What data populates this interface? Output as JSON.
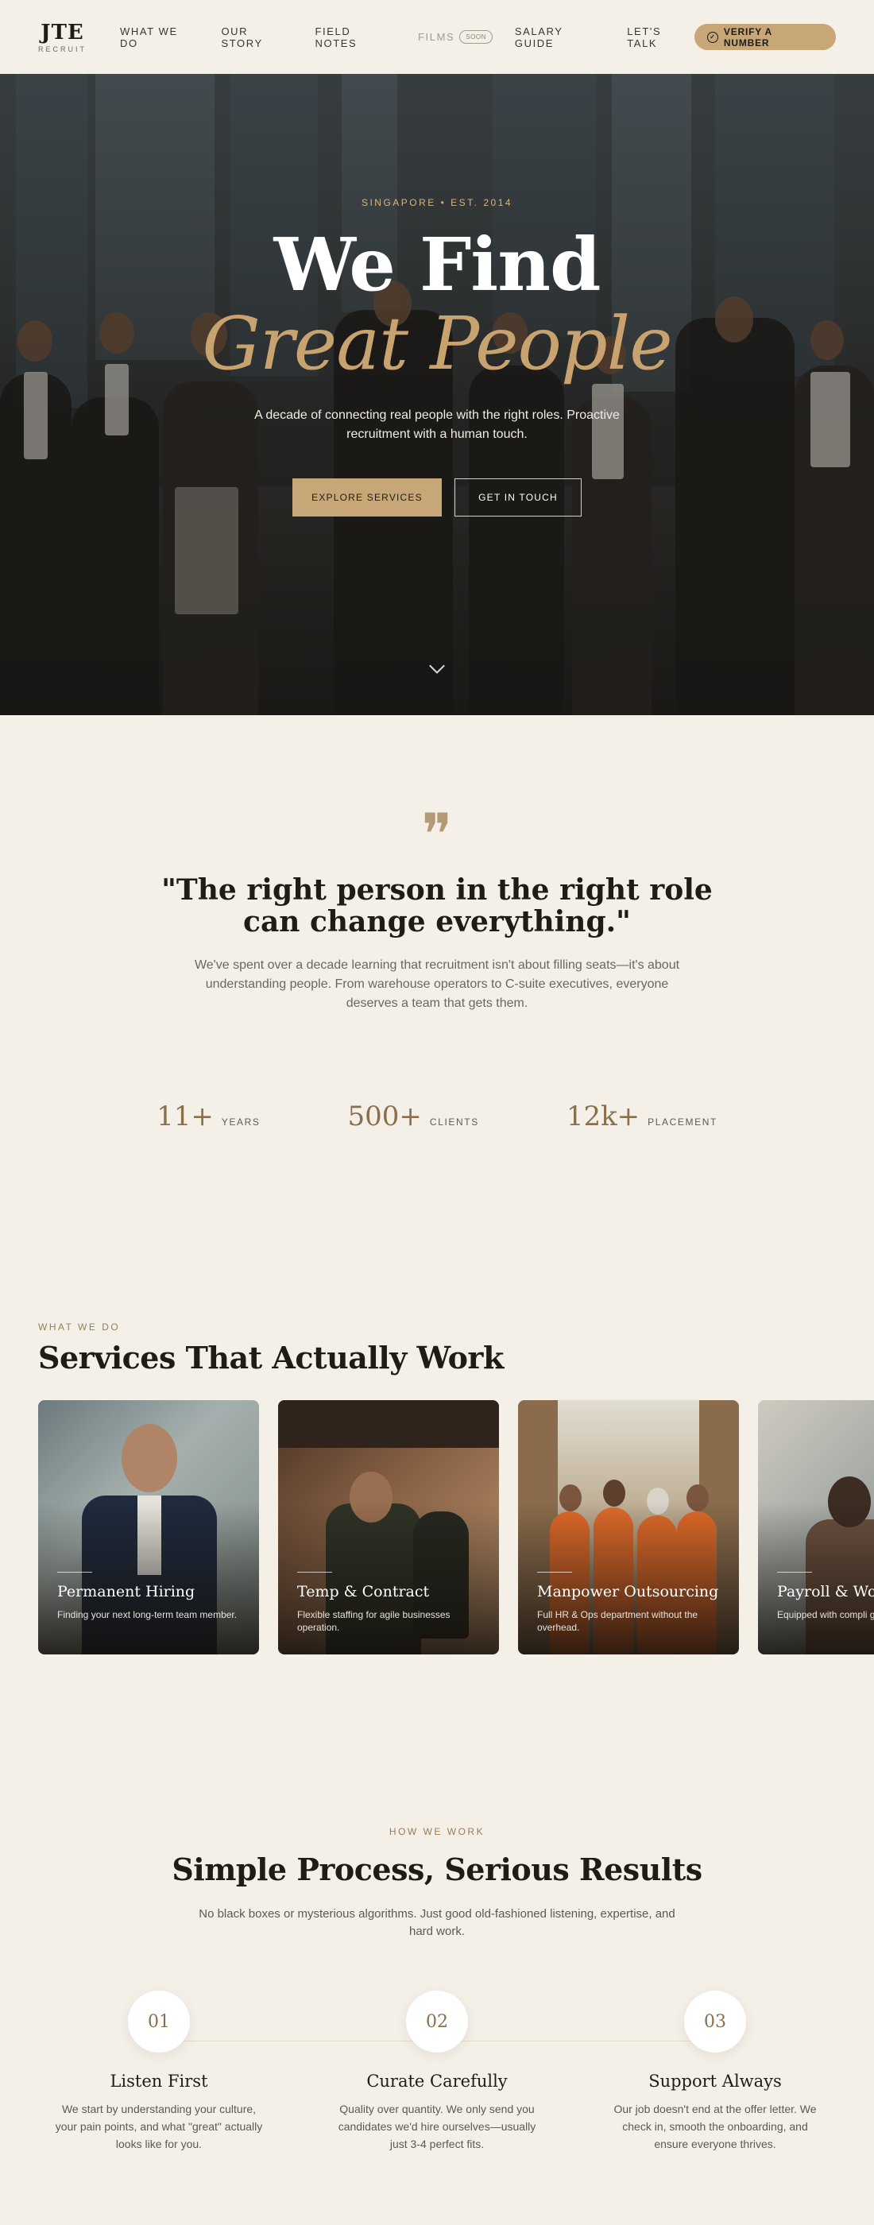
{
  "nav": {
    "logo_main": "JTE",
    "logo_sub": "RECRUIT",
    "links": [
      "WHAT WE DO",
      "OUR STORY",
      "FIELD NOTES",
      "FILMS",
      "SALARY GUIDE",
      "LET'S TALK"
    ],
    "films_badge": "SOON",
    "verify_label": "VERIFY A NUMBER"
  },
  "hero": {
    "eyebrow": "SINGAPORE • EST. 2014",
    "title_line1": "We Find",
    "title_line2": "Great People",
    "subtitle": "A decade of connecting real people with the right roles. Proactive recruitment with a human touch.",
    "primary_cta": "EXPLORE SERVICES",
    "secondary_cta": "GET IN TOUCH"
  },
  "quote": {
    "mark": "❞",
    "text": "\"The right person in the right role can change everything.\"",
    "body": "We've spent over a decade learning that recruitment isn't about filling seats—it's about understanding people. From warehouse operators to C-suite executives, everyone deserves a team that gets them."
  },
  "stats": [
    {
      "value": "11+",
      "label": "YEARS"
    },
    {
      "value": "500+",
      "label": "CLIENTS"
    },
    {
      "value": "12k+",
      "label": "PLACEMENT"
    }
  ],
  "services": {
    "eyebrow": "WHAT WE DO",
    "title": "Services That Actually Work",
    "cards": [
      {
        "title": "Permanent Hiring",
        "desc": "Finding your next long-term team member."
      },
      {
        "title": "Temp & Contract",
        "desc": "Flexible staffing for agile businesses operation."
      },
      {
        "title": "Manpower Outsourcing",
        "desc": "Full HR & Ops department without the overhead."
      },
      {
        "title": "Payroll & Work",
        "desc": "Equipped with compli guaranteed."
      }
    ]
  },
  "process": {
    "eyebrow": "HOW WE WORK",
    "title": "Simple Process, Serious Results",
    "subtitle": "No black boxes or mysterious algorithms. Just good old-fashioned listening, expertise, and hard work.",
    "steps": [
      {
        "num": "01",
        "title": "Listen First",
        "desc": "We start by understanding your culture, your pain points, and what \"great\" actually looks like for you."
      },
      {
        "num": "02",
        "title": "Curate Carefully",
        "desc": "Quality over quantity. We only send you candidates we'd hire ourselves—usually just 3-4 perfect fits."
      },
      {
        "num": "03",
        "title": "Support Always",
        "desc": "Our job doesn't end at the offer letter. We check in, smooth the onboarding, and ensure everyone thrives."
      }
    ]
  }
}
